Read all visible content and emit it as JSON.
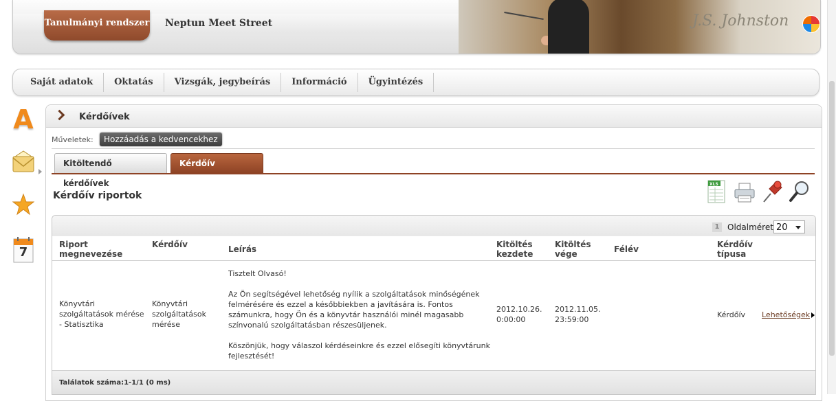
{
  "header": {
    "system_tab": "Tanulmányi rendszer",
    "title": "Neptun Meet Street",
    "brand_color": "#9a4f2f"
  },
  "menu": {
    "items": [
      "Saját adatok",
      "Oktatás",
      "Vizsgák, jegybeírás",
      "Információ",
      "Ügyintézés"
    ]
  },
  "sidebar": {
    "icons": [
      "a-letter-icon",
      "mail-icon",
      "star-icon",
      "calendar-icon"
    ],
    "calendar_day": "7",
    "a_letter": "A"
  },
  "panel": {
    "title": "Kérdőívek",
    "operations_label": "Műveletek:",
    "favorite_button": "Hozzáadás a kedvencekhez",
    "tabs": [
      {
        "label": "Kitöltendő kérdőívek",
        "active": false
      },
      {
        "label": "Kérdőív riportok",
        "active": true
      }
    ],
    "section_title": "Kérdőív riportok",
    "tools": [
      "xls-export-icon",
      "print-icon",
      "pin-icon",
      "search-icon"
    ]
  },
  "grid": {
    "current_page": "1",
    "page_size_label": "Oldalméret",
    "page_size_value": "20",
    "columns": [
      {
        "l1": "Riport",
        "l2": "megnevezése"
      },
      {
        "l1": "Kérdőív",
        "l2": ""
      },
      {
        "l1": "Leírás",
        "l2": ""
      },
      {
        "l1": "Kitöltés",
        "l2": "kezdete"
      },
      {
        "l1": "Kitöltés",
        "l2": "vége"
      },
      {
        "l1": "Félév",
        "l2": ""
      },
      {
        "l1": "Kérdőív",
        "l2": "típusa"
      }
    ],
    "row": {
      "name": [
        "Könyvtári",
        "szolgáltatások mérése",
        "- Statisztika"
      ],
      "survey": [
        "Könyvtári",
        "szolgáltatások",
        "mérése"
      ],
      "description": [
        "Tisztelt Olvasó!",
        "Az Ön segítségével lehetőség nyílik a szolgáltatások minőségének felmérésére és ezzel a későbbiekben a javítására is. Fontos számunkra, hogy Ön és a könyvtár használói minél magasabb színvonalú szolgáltatásban részesüljenek.",
        "Köszönjük, hogy válaszol kérdéseinkre és ezzel elősegíti könyvtárunk fejlesztését!"
      ],
      "start": [
        "2012.10.26.",
        "0:00:00"
      ],
      "end": [
        "2012.11.05.",
        "23:59:00"
      ],
      "semester": "",
      "type": "Kérdőív",
      "options_link": "Lehetőségek"
    },
    "result_count": "Találatok száma:1-1/1 (0 ms)"
  }
}
